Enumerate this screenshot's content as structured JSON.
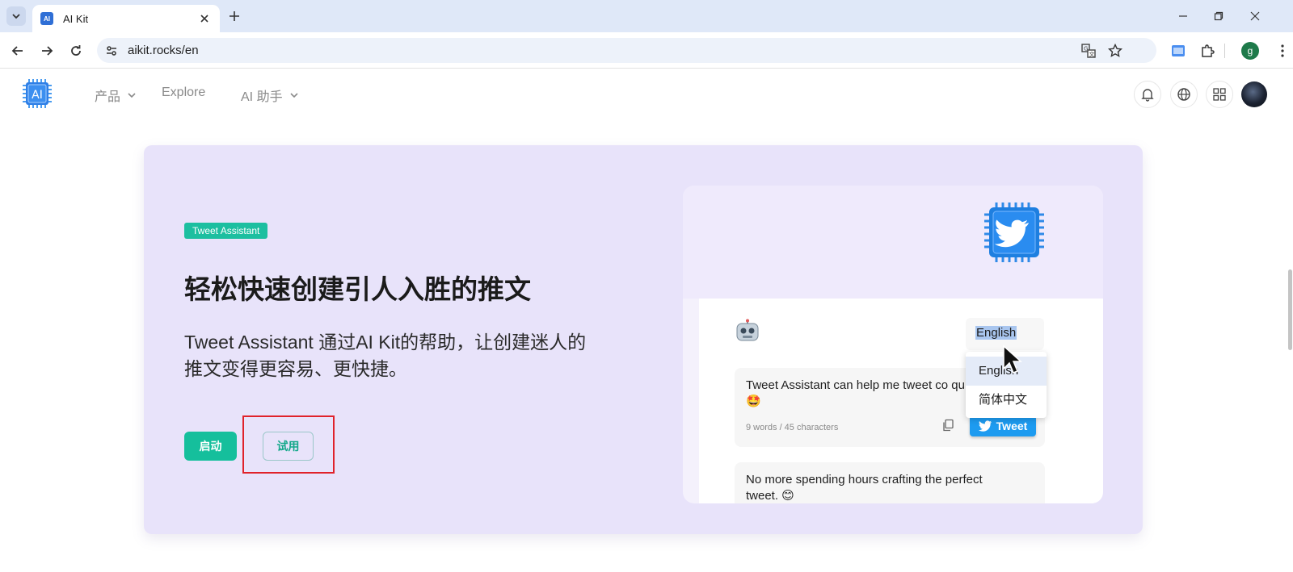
{
  "browser": {
    "tab_title": "AI Kit",
    "url": "aikit.rocks/en",
    "profile_initial": "g"
  },
  "nav": {
    "logo_text": "AI",
    "items": [
      {
        "label": "产品",
        "has_dropdown": true
      },
      {
        "label": "Explore",
        "has_dropdown": false
      },
      {
        "label": "AI 助手",
        "has_dropdown": true
      }
    ]
  },
  "hero": {
    "badge": "Tweet Assistant",
    "title": "轻松快速创建引人入胜的推文",
    "description": "Tweet Assistant 通过AI Kit的帮助，让创建迷人的推文变得更容易、更快捷。",
    "launch_label": "启动",
    "try_label": "试用"
  },
  "preview": {
    "language_selected": "English",
    "language_options": [
      "English",
      "简体中文"
    ],
    "tweets": [
      {
        "text": "Tweet Assistant can help me tweet co quickly. 🤩",
        "meta": "9 words / 45 characters",
        "button": "Tweet"
      },
      {
        "text": "No more spending hours crafting the perfect tweet. 😊"
      }
    ]
  },
  "colors": {
    "accent": "#15bf9c",
    "hero_bg": "#e8e3fa",
    "tweet_blue": "#1d9bf0",
    "highlight_red": "#e0222a"
  }
}
